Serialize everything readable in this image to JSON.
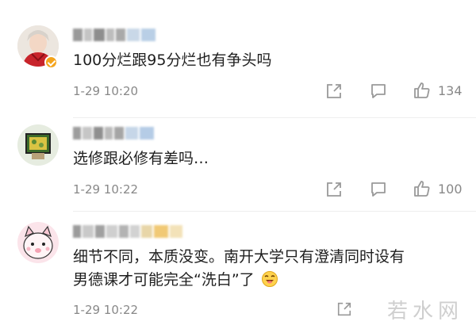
{
  "comments": [
    {
      "text": "100分烂跟95分烂也有争头吗",
      "time": "1-29 10:20",
      "likes": "134",
      "avatar_icon": "user-avatar-red-hoodie",
      "verified": true
    },
    {
      "text": "选修跟必修有差吗…",
      "time": "1-29 10:22",
      "likes": "100",
      "avatar_icon": "user-avatar-painting",
      "verified": false
    },
    {
      "text_line1": "细节不同，本质没变。南开大学只有澄清同时设有",
      "text_line2": "男德课才可能完全“洗白”了",
      "emoji_icon": "laughing-emoji-icon",
      "time": "1-29 10:22",
      "avatar_icon": "user-avatar-pink-cartoon",
      "verified": false
    }
  ],
  "watermark": "若水网",
  "colors": {
    "text": "#1f1f1f",
    "meta": "#888888",
    "icon": "#999999",
    "verified": "#f4a41c",
    "divider": "#eeeeee"
  }
}
